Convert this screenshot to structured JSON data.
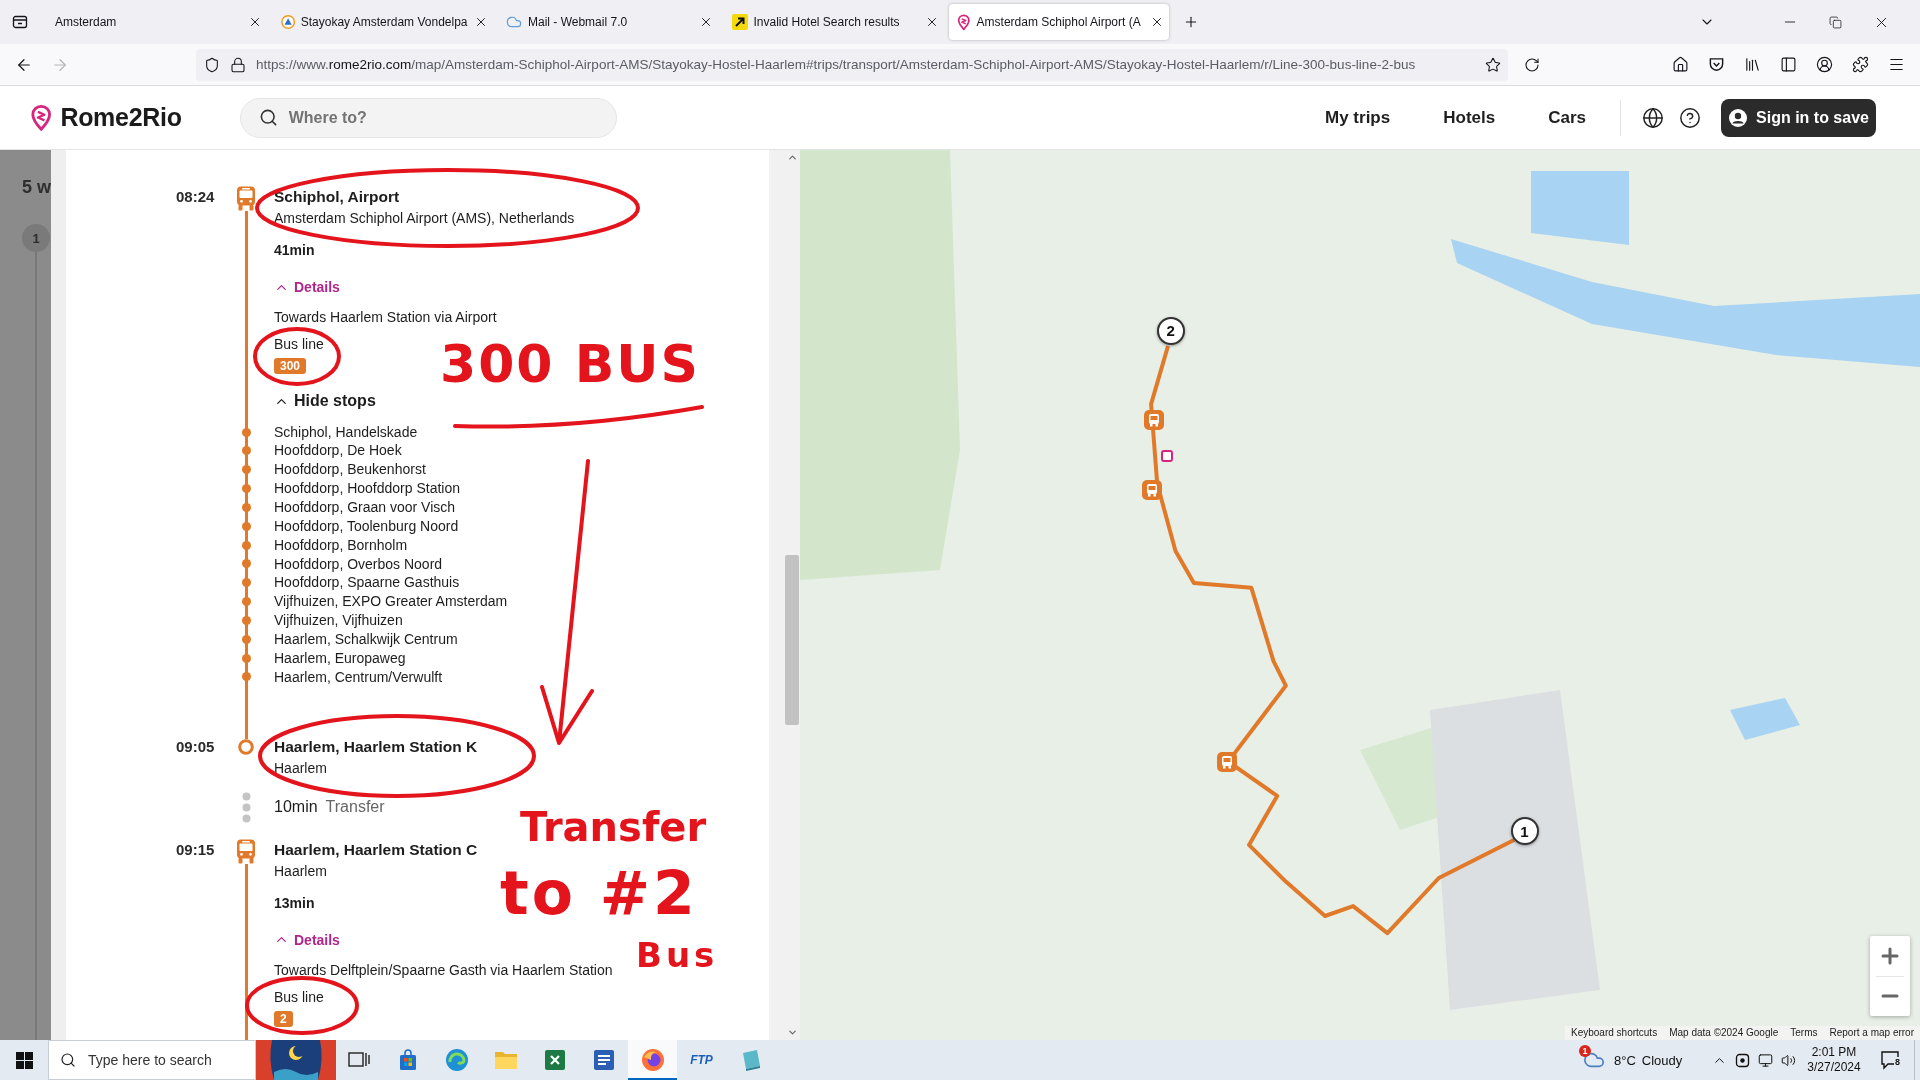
{
  "browser": {
    "tabs": [
      {
        "title": "Amsterdam",
        "selected": false
      },
      {
        "title": "Stayokay Amsterdam Vondelpa",
        "favicon": {
          "kind": "triangle"
        },
        "selected": false
      },
      {
        "title": "Mail - Webmail 7.0",
        "favicon": {
          "kind": "cloud"
        },
        "selected": false
      },
      {
        "title": "Invalid Hotel Search results",
        "favicon": {
          "kind": "arrow"
        },
        "selected": false
      },
      {
        "title": "Amsterdam Schiphol Airport (A",
        "favicon": {
          "kind": "pin"
        },
        "selected": true
      }
    ],
    "nav_buttons": [
      {
        "kind": "back",
        "disabled": false
      },
      {
        "kind": "forward",
        "disabled": true
      }
    ],
    "url": {
      "prefix": "https://www.",
      "host": "rome2rio.com",
      "path": "/map/Amsterdam-Schiphol-Airport-AMS/Stayokay-Hostel-Haarlem#trips/transport/Amsterdam-Schiphol-Airport-AMS/Stayokay-Hostel-Haarlem/r/Line-300-bus-line-2-bus"
    }
  },
  "header": {
    "logo": "Rome2Rio",
    "search": {
      "placeholder": "Where to?"
    },
    "nav": [
      {
        "label": "My trips"
      },
      {
        "label": "Hotels"
      },
      {
        "label": "Cars"
      }
    ],
    "sign_in": "Sign in to save"
  },
  "background_page": {
    "heading": "5 w",
    "step": "1"
  },
  "journey": [
    {
      "kind": "ride",
      "vehicle": {
        "kind": "bus"
      },
      "time": "08:24",
      "title": "Schiphol, Airport",
      "subtitle": "Amsterdam Schiphol Airport (AMS), Netherlands",
      "duration": "41min",
      "details": {
        "label": "Details",
        "expanded": true
      },
      "direction": "Towards Haarlem Station via Airport",
      "line_label": "Bus line",
      "line": "300",
      "stops_toggle": {
        "label": "Hide stops",
        "expanded": true
      },
      "stops": [
        "Schiphol, Handelskade",
        "Hoofddorp, De Hoek",
        "Hoofddorp, Beukenhorst",
        "Hoofddorp, Hoofddorp Station",
        "Hoofddorp, Graan voor Visch",
        "Hoofddorp, Toolenburg Noord",
        "Hoofddorp, Bornholm",
        "Hoofddorp, Overbos Noord",
        "Hoofddorp, Spaarne Gasthuis",
        "Vijfhuizen, EXPO Greater Amsterdam",
        "Vijfhuizen, Vijfhuizen",
        "Haarlem, Schalkwijk Centrum",
        "Haarlem, Europaweg",
        "Haarlem, Centrum/Verwulft"
      ]
    },
    {
      "kind": "arrival",
      "time": "09:05",
      "title": "Haarlem, Haarlem Station K",
      "subtitle": "Haarlem"
    },
    {
      "kind": "transfer",
      "duration": "10min",
      "label": "Transfer"
    },
    {
      "kind": "ride",
      "vehicle": {
        "kind": "bus"
      },
      "time": "09:15",
      "title": "Haarlem, Haarlem Station C",
      "subtitle": "Haarlem",
      "duration": "13min",
      "details": {
        "label": "Details",
        "expanded": true
      },
      "direction": "Towards Delftplein/Spaarne Gasth via Haarlem Station",
      "line_label": "Bus line",
      "line": "2"
    }
  ],
  "annotations": [
    {
      "text": "300 BUS"
    },
    {
      "text": "Transfer"
    },
    {
      "text": "to #2"
    },
    {
      "text": "Bus"
    }
  ],
  "map": {
    "markers": [
      {
        "label": "2"
      },
      {
        "label": "1"
      }
    ],
    "footer": [
      "Keyboard shortcuts",
      "Map data ©2024 Google",
      "Terms",
      "Report a map error"
    ]
  },
  "taskbar": {
    "search": {
      "placeholder": "Type here to search"
    },
    "apps": [
      {
        "kind": "task_view",
        "selected": false
      },
      {
        "kind": "store",
        "selected": false
      },
      {
        "kind": "browser",
        "selected": false
      },
      {
        "kind": "folder",
        "selected": false
      },
      {
        "kind": "spreadsheet",
        "selected": false
      },
      {
        "kind": "document",
        "selected": false
      },
      {
        "kind": "fox_browser",
        "selected": true
      },
      {
        "kind": "ftp",
        "label": "FTP",
        "selected": false
      },
      {
        "kind": "notebook",
        "selected": false
      }
    ],
    "weather": {
      "alerts": "1",
      "temperature": "8°C",
      "condition": "Cloudy"
    },
    "time": "2:01 PM",
    "date": "3/27/2024",
    "notifications": "8"
  }
}
